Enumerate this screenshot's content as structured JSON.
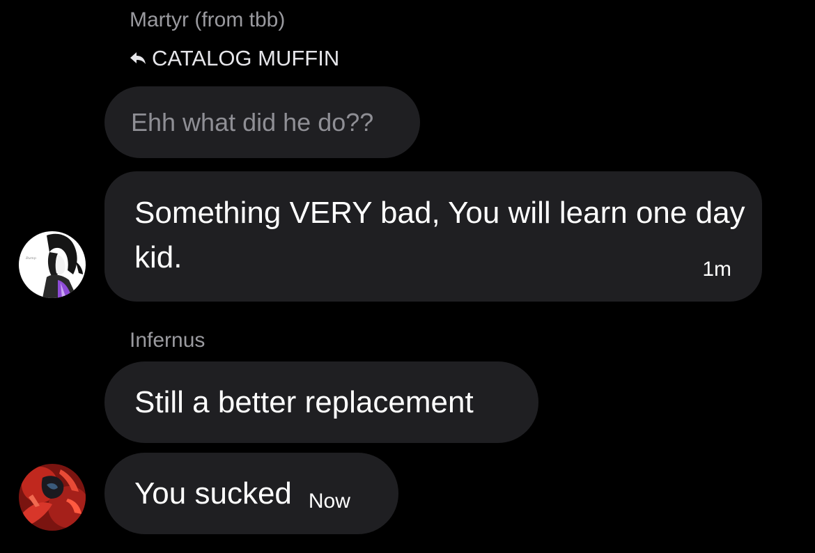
{
  "conversation": {
    "messages": [
      {
        "sender": "Martyr (from tbb)",
        "reply_to": "CATALOG MUFFIN",
        "quoted_text": "Ehh what did he do??",
        "text": "Something VERY bad, You will learn one day kid.",
        "time": "1m",
        "avatar": "anime-character-avatar"
      },
      {
        "sender": "Infernus",
        "texts": [
          "Still a better replacement",
          "You sucked"
        ],
        "time": "Now",
        "avatar": "red-character-avatar"
      }
    ]
  },
  "icons": {
    "reply": "reply-arrow-icon"
  },
  "colors": {
    "background": "#000000",
    "bubble": "#1f1f22",
    "sender_name": "#9a9a9f",
    "quoted_text": "#8f8f95",
    "message_text": "#ffffff"
  }
}
